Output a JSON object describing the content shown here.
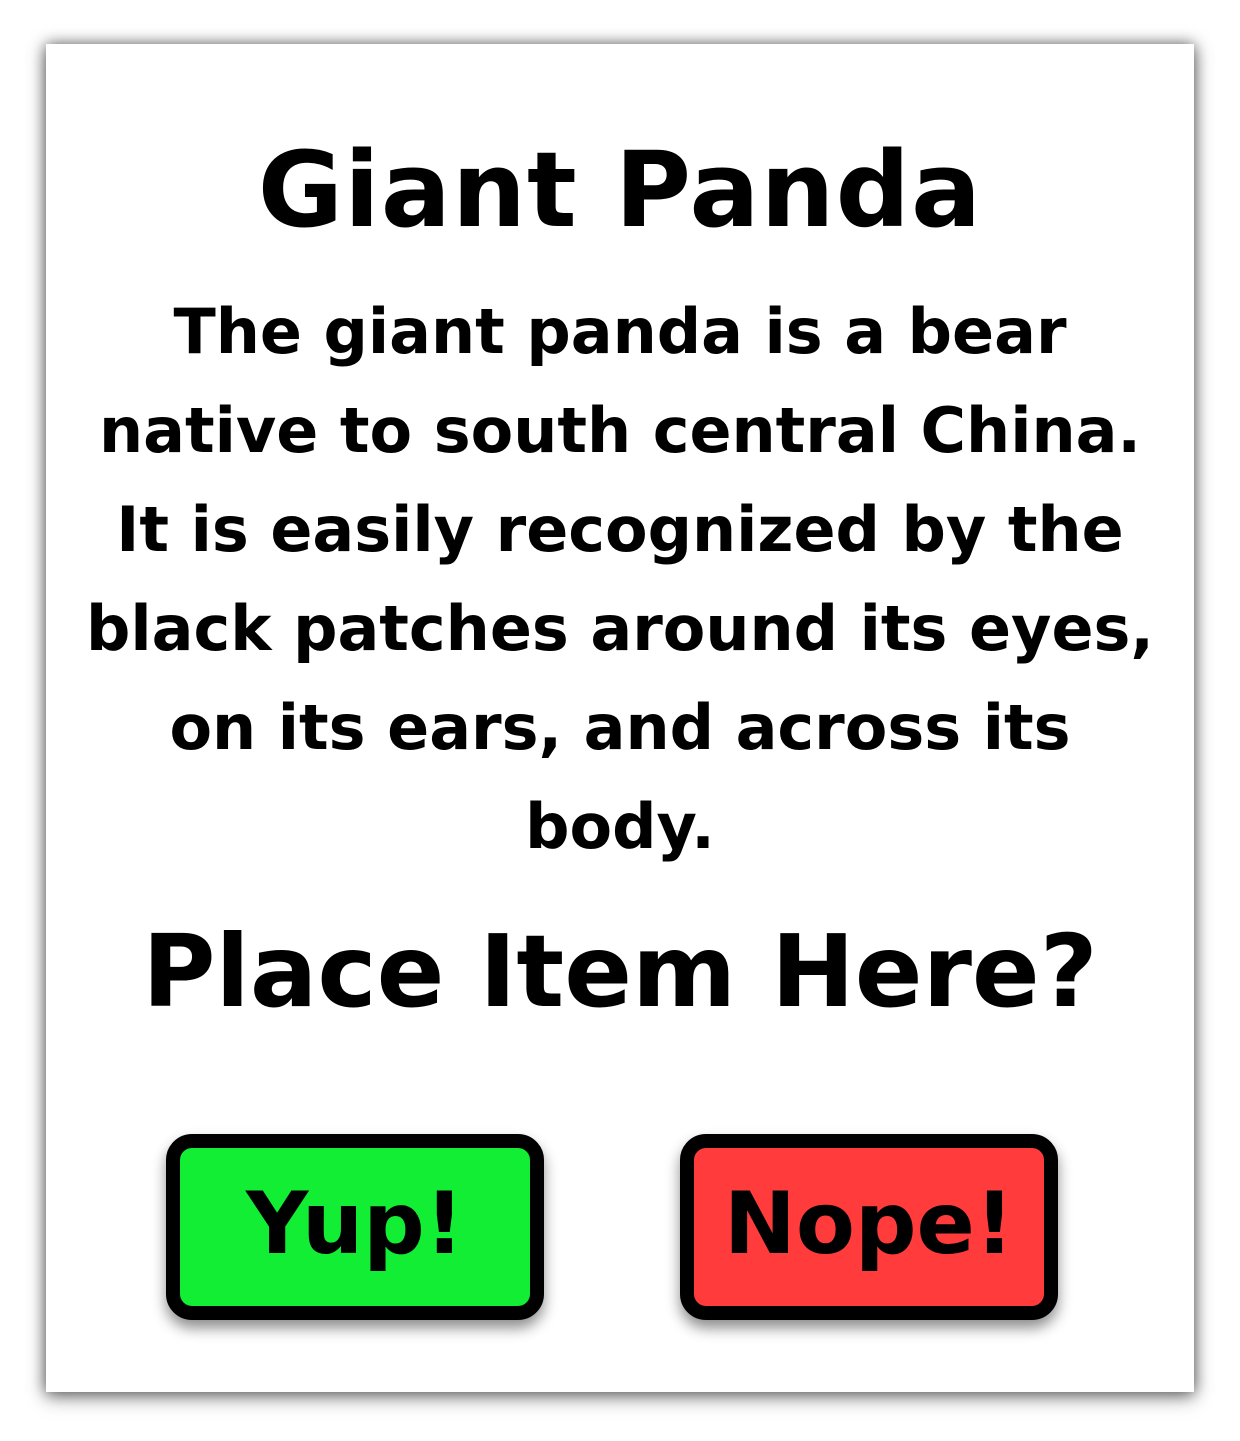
{
  "card": {
    "title": "Giant Panda",
    "description": "The giant panda is a bear native to south central China. It is easily recognized by the black patches around its eyes, on its ears, and across its body.",
    "prompt": "Place Item Here?"
  },
  "buttons": {
    "yes_label": "Yup!",
    "no_label": "Nope!"
  },
  "colors": {
    "yes_button": "#11ee33",
    "no_button": "#ff3b3b",
    "border": "#000000",
    "background": "#ffffff"
  }
}
